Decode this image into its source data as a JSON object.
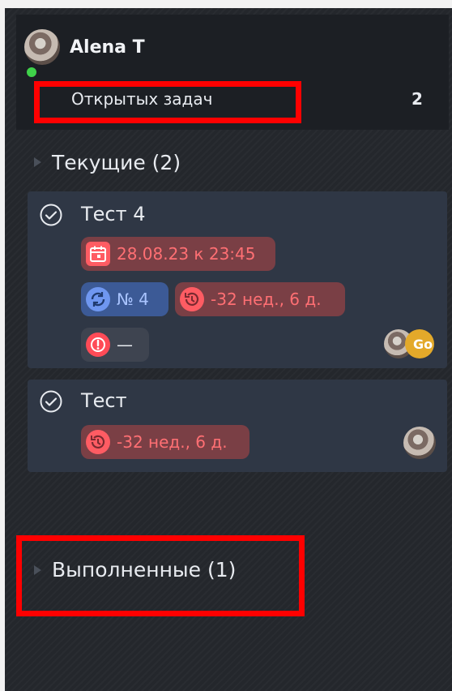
{
  "colors": {
    "panel": "#24272c",
    "card": "#2f3745",
    "chip_red": "#7a3f45",
    "chip_red_text": "#ff6f73",
    "chip_blue": "#3c5a96",
    "highlight": "#ff0000",
    "online": "#3fd24a",
    "badge": "#e3a92a"
  },
  "user": {
    "name": "Alena T",
    "avatar_icon": "user-avatar",
    "online": true
  },
  "open_tasks": {
    "label": "Открытых задач",
    "count": "2"
  },
  "sections": {
    "current": "Текущие (2)",
    "done": "Выполненные (1)"
  },
  "tasks": [
    {
      "title": "Тест 4",
      "deadline": "28.08.23 к 23:45",
      "number": "№ 4",
      "overdue": "-32 нед., 6 д.",
      "priority": "—",
      "assignee_badge": "Go"
    },
    {
      "title": "Тест",
      "overdue": "-32 нед., 6 д."
    }
  ]
}
